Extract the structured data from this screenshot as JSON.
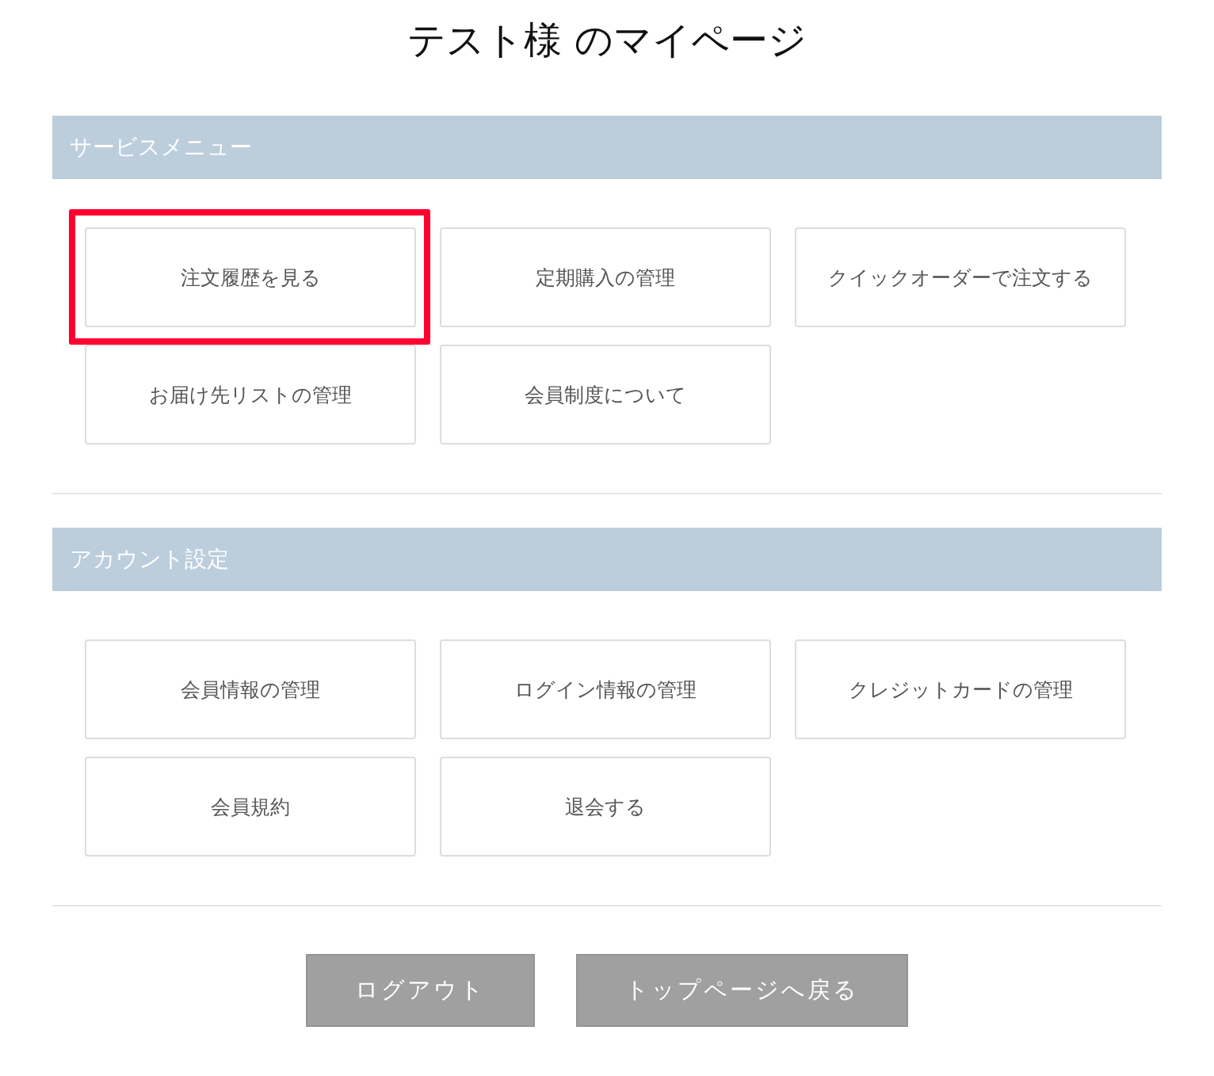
{
  "title": "テスト様 のマイページ",
  "sections": [
    {
      "heading": "サービスメニュー",
      "items": [
        {
          "label": "注文履歴を見る",
          "highlighted": true
        },
        {
          "label": "定期購入の管理",
          "highlighted": false
        },
        {
          "label": "クイックオーダーで注文する",
          "highlighted": false
        },
        {
          "label": "お届け先リストの管理",
          "highlighted": false
        },
        {
          "label": "会員制度について",
          "highlighted": false
        }
      ]
    },
    {
      "heading": "アカウント設定",
      "items": [
        {
          "label": "会員情報の管理",
          "highlighted": false
        },
        {
          "label": "ログイン情報の管理",
          "highlighted": false
        },
        {
          "label": "クレジットカードの管理",
          "highlighted": false
        },
        {
          "label": "会員規約",
          "highlighted": false
        },
        {
          "label": "退会する",
          "highlighted": false
        }
      ]
    }
  ],
  "buttons": [
    "ログアウト",
    "トップページへ戻る"
  ]
}
